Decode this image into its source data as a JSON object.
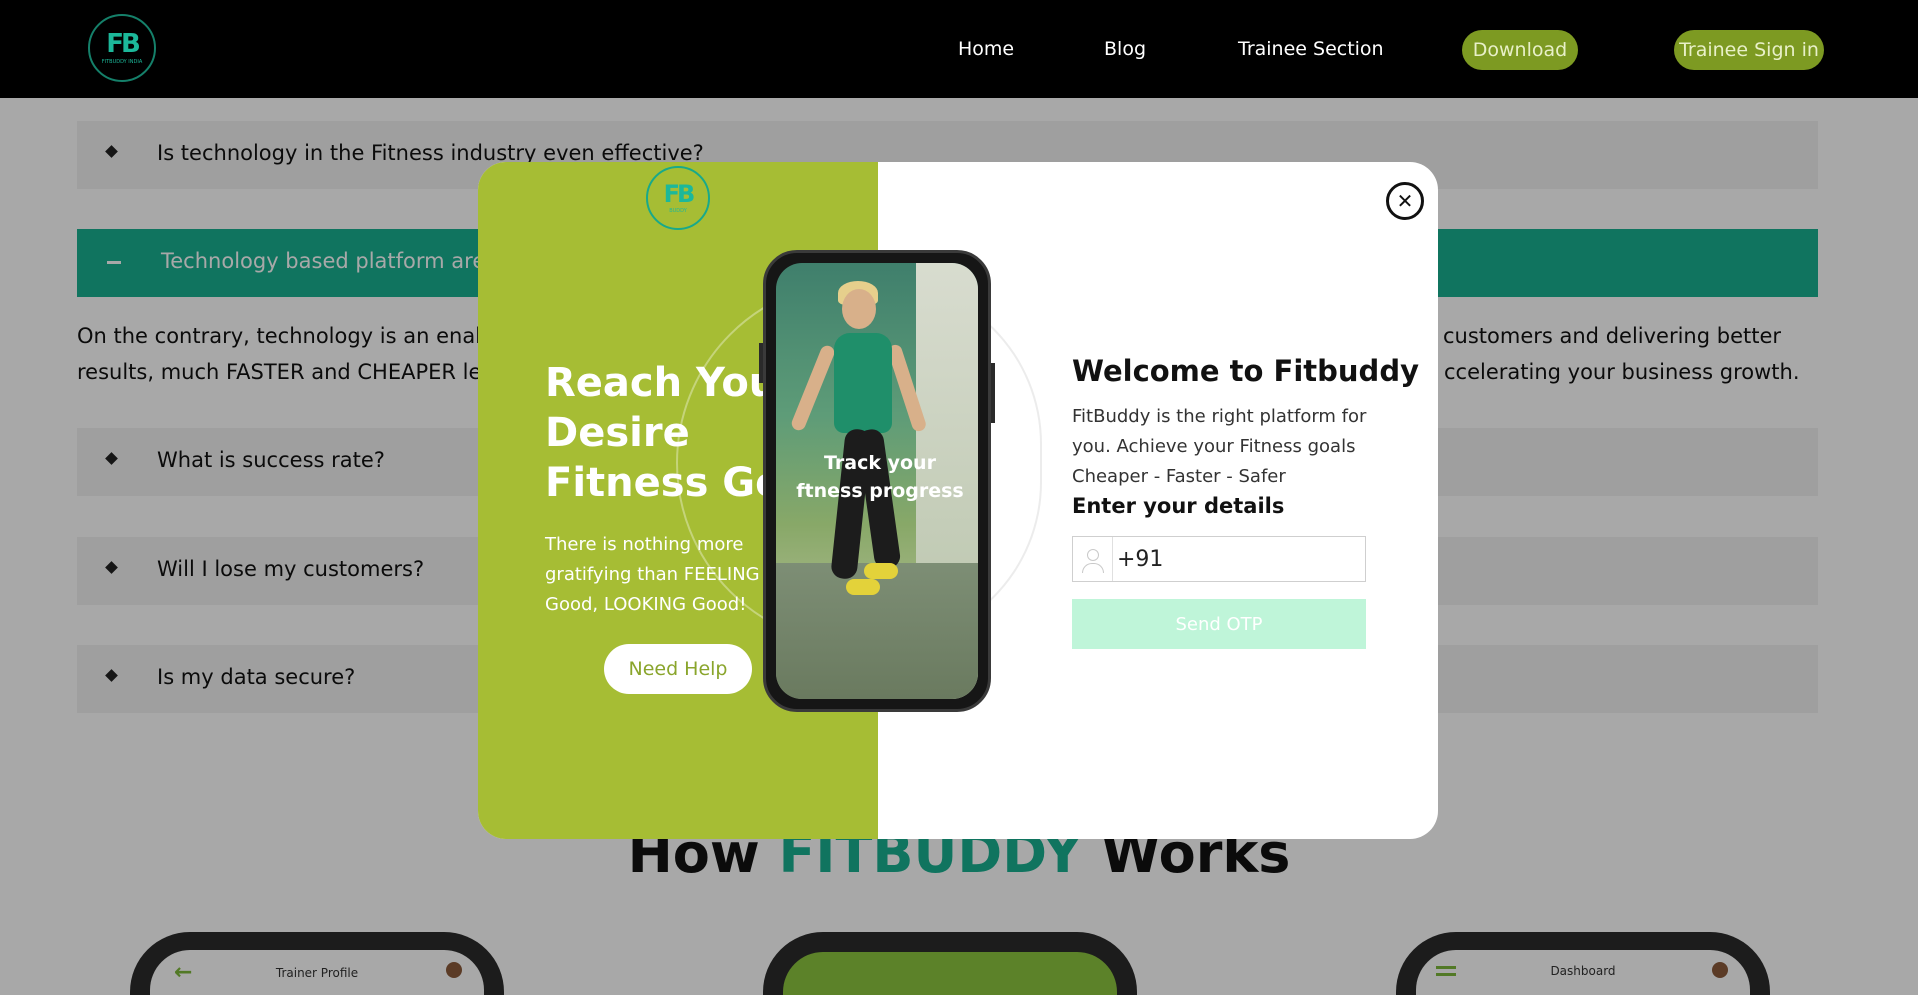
{
  "nav": {
    "logo_text": "FB",
    "logo_sub": "FITBUDDY INDIA",
    "links": [
      "Home",
      "Blog",
      "Trainee Section"
    ],
    "download": "Download",
    "sign_in": "Trainee Sign in"
  },
  "faq": {
    "items": [
      "Is technology in the Fitness industry even effective?",
      "Technology based platform are ve",
      "What is success rate?",
      "Will I lose my customers?",
      "Is my data secure?"
    ],
    "answer_line1_left": "On the contrary, technology is an enabler th",
    "answer_line1_right": "customers and delivering better",
    "answer_line2_left": "results, much FASTER and CHEAPER leadin",
    "answer_line2_right": "ccelerating your business growth."
  },
  "works": {
    "prefix": "How ",
    "brand": "FITBUDDY",
    "suffix": " Works",
    "cards": [
      "Trainer Profile",
      "",
      "Dashboard"
    ]
  },
  "modal": {
    "logo_text": "FB",
    "logo_sub": "BUDDY",
    "headline": "Reach Your Desire Fitness Goal",
    "tagline": "There is nothing more gratifying than FEELING Good, LOOKING Good!",
    "help": "Need Help",
    "phone_caption_1": "Track your",
    "phone_caption_2": "ftness progress",
    "close": "✕",
    "welcome": "Welcome to Fitbuddy",
    "desc": "FitBuddy is the right platform for you. Achieve your Fitness goals Cheaper - Faster - Safer",
    "enter": "Enter your details",
    "phone_value": "+91",
    "send": "Send OTP"
  },
  "colors": {
    "accent_olive": "#7d9a22",
    "modal_green": "#a6bd34",
    "teal": "#19b091",
    "otp_button": "#bff5d9"
  }
}
